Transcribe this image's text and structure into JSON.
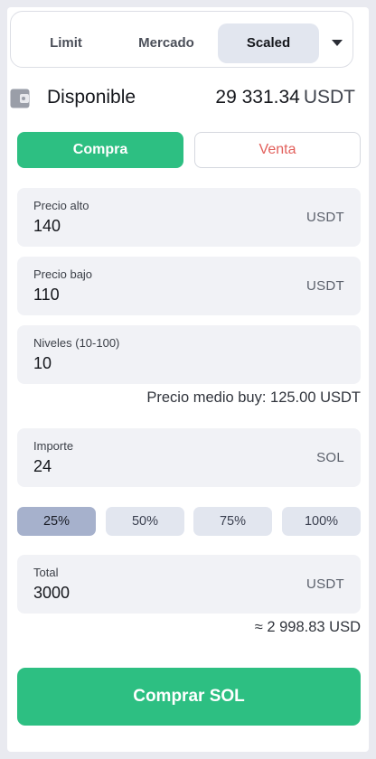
{
  "order_types": {
    "limit": "Limit",
    "market": "Mercado",
    "scaled": "Scaled",
    "active": "Scaled"
  },
  "available": {
    "label": "Disponible",
    "amount": "29 331.34",
    "currency": "USDT"
  },
  "side": {
    "buy": "Compra",
    "sell": "Venta",
    "active": "Compra"
  },
  "fields": {
    "high_price": {
      "label": "Precio alto",
      "value": "140",
      "unit": "USDT"
    },
    "low_price": {
      "label": "Precio bajo",
      "value": "110",
      "unit": "USDT"
    },
    "levels": {
      "label": "Niveles (10-100)",
      "value": "10"
    },
    "amount": {
      "label": "Importe",
      "value": "24",
      "unit": "SOL"
    },
    "total": {
      "label": "Total",
      "value": "3000",
      "unit": "USDT"
    }
  },
  "average_price_text": "Precio medio buy: 125.00 USDT",
  "percent_buttons": [
    "25%",
    "50%",
    "75%",
    "100%"
  ],
  "percent_active": "25%",
  "approx_usd_text": "≈ 2 998.83 USD",
  "submit_label": "Comprar SOL",
  "colors": {
    "buy_green": "#2dbf82",
    "sell_red": "#e2605c",
    "active_tab": "#e2e6ef",
    "active_percent": "#a6b1cc"
  },
  "icons": {
    "wallet": "wallet-icon",
    "dropdown": "caret-down-icon"
  }
}
